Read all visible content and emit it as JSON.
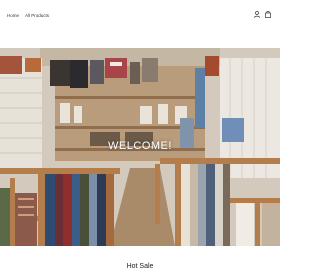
{
  "nav": {
    "home_label": "Home",
    "all_products_label": "All Products"
  },
  "header": {
    "account_icon": "user-icon",
    "cart_icon": "shopping-bag-icon"
  },
  "hero": {
    "title": "WELCOME!"
  },
  "section": {
    "title": "Hot Sale"
  },
  "colors": {
    "background": "#ffffff",
    "text": "#222222",
    "hero_text": "#ffffff"
  }
}
